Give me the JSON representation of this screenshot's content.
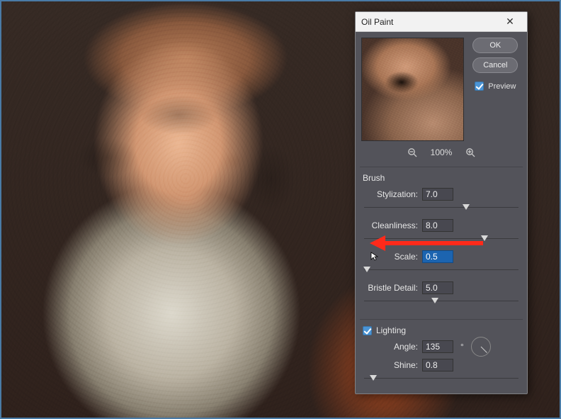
{
  "dialog": {
    "title": "Oil Paint",
    "ok_label": "OK",
    "cancel_label": "Cancel",
    "preview_label": "Preview",
    "preview_checked": true,
    "zoom": {
      "percent": "100%"
    }
  },
  "brush": {
    "section_label": "Brush",
    "stylization": {
      "label": "Stylization:",
      "value": "7.0",
      "slider_pos": 0.66
    },
    "cleanliness": {
      "label": "Cleanliness:",
      "value": "8.0",
      "slider_pos": 0.78
    },
    "scale": {
      "label": "Scale:",
      "value": "0.5",
      "slider_pos": 0.02,
      "selected": true
    },
    "bristle": {
      "label": "Bristle Detail:",
      "value": "5.0",
      "slider_pos": 0.46
    }
  },
  "lighting": {
    "section_label": "Lighting",
    "checked": true,
    "angle": {
      "label": "Angle:",
      "value": "135",
      "unit": "°"
    },
    "shine": {
      "label": "Shine:",
      "value": "0.8",
      "slider_pos": 0.06
    }
  }
}
